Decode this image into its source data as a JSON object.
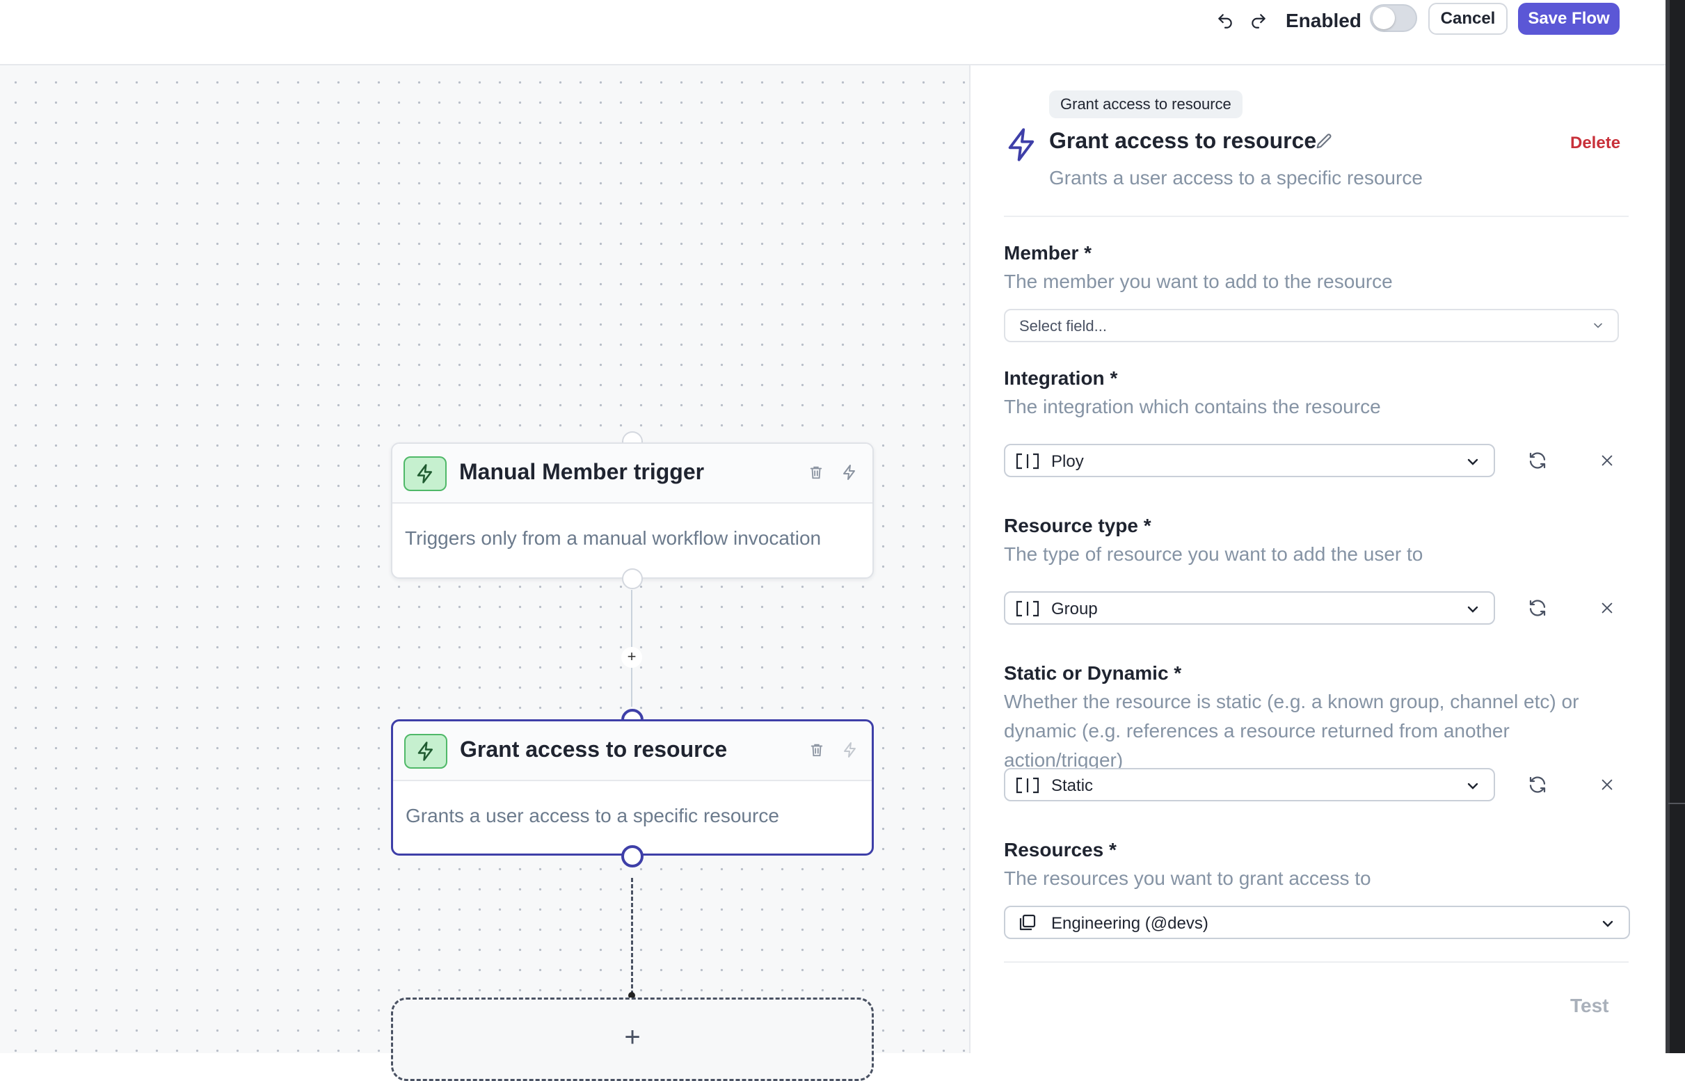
{
  "topbar": {
    "enabled_label": "Enabled",
    "enabled": false,
    "cancel_label": "Cancel",
    "save_label": "Save Flow"
  },
  "canvas": {
    "trigger_node": {
      "title": "Manual Member trigger",
      "description": "Triggers only from a manual workflow invocation"
    },
    "action_node": {
      "title": "Grant access to resource",
      "description": "Grants a user access to a specific resource"
    },
    "add_step_glyph": "+",
    "add_node_glyph": "+"
  },
  "panel": {
    "badge": "Grant access to resource",
    "title": "Grant access to resource",
    "delete_label": "Delete",
    "description": "Grants a user access to a specific resource",
    "fields": {
      "member": {
        "label": "Member *",
        "help": "The member you want to add to the resource",
        "placeholder": "Select field..."
      },
      "integration": {
        "label": "Integration *",
        "help": "The integration which contains the resource",
        "value": "Ploy"
      },
      "resource_type": {
        "label": "Resource type *",
        "help": "The type of resource you want to add the user to",
        "value": "Group"
      },
      "static_or_dynamic": {
        "label": "Static or Dynamic *",
        "help": "Whether the resource is static (e.g. a known group, channel etc) or dynamic (e.g. references a resource returned from another action/trigger)",
        "value": "Static"
      },
      "resources": {
        "label": "Resources *",
        "help": "The resources you want to grant access to",
        "value": "Engineering (@devs)"
      }
    },
    "test_label": "Test"
  },
  "colors": {
    "accent": "#5b57d6",
    "selected_border": "#3e3fa8",
    "node_icon_bg": "#c6f0cf",
    "node_icon_border": "#4fb868",
    "danger": "#c8303a",
    "muted_text": "#8593a4"
  },
  "icons": {
    "undo": "undo-icon",
    "redo": "redo-icon",
    "node": "lightning-bolt-icon",
    "trash": "trash-icon",
    "edit": "pencil-icon",
    "variable": "variable-bracket-icon",
    "refresh": "refresh-icon",
    "clear": "close-icon",
    "chevron": "chevron-down-icon",
    "copy": "copy-icon"
  }
}
